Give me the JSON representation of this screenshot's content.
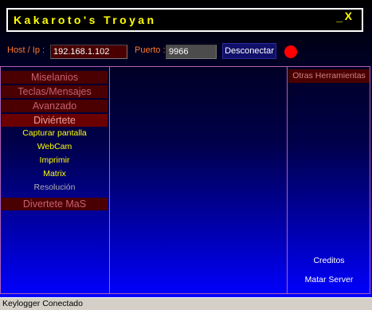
{
  "window": {
    "title": "Kakaroto's Troyan",
    "minimize_glyph": "_",
    "close_glyph": "X"
  },
  "connection": {
    "host_label": "Host / Ip :",
    "host_value": "192.168.1.102",
    "port_label": "Puerto :",
    "port_value": "9966",
    "disconnect_label": "Desconectar",
    "status_color": "#ff0000"
  },
  "left_menu": {
    "miscellaneous": "Miselanios",
    "keys_messages": "Teclas/Mensajes",
    "advanced": "Avanzado",
    "fun": "Diviértete",
    "fun_items": [
      "Capturar pantalla",
      "WebCam",
      "Imprimir",
      "Matrix",
      "Resolución"
    ],
    "more_fun": "Divertete MaS"
  },
  "right_menu": {
    "other_tools": "Otras Herramientas",
    "credits": "Creditos",
    "kill_server": "Matar Server"
  },
  "statusbar": {
    "text": "Keylogger Conectado"
  },
  "colors": {
    "title": "#ffff00",
    "label": "#ff7a2a",
    "menu_bg": "#4a0000",
    "menu_text": "#c86070",
    "submenu_text": "#ffff00",
    "panel_border": "#b060b0"
  }
}
